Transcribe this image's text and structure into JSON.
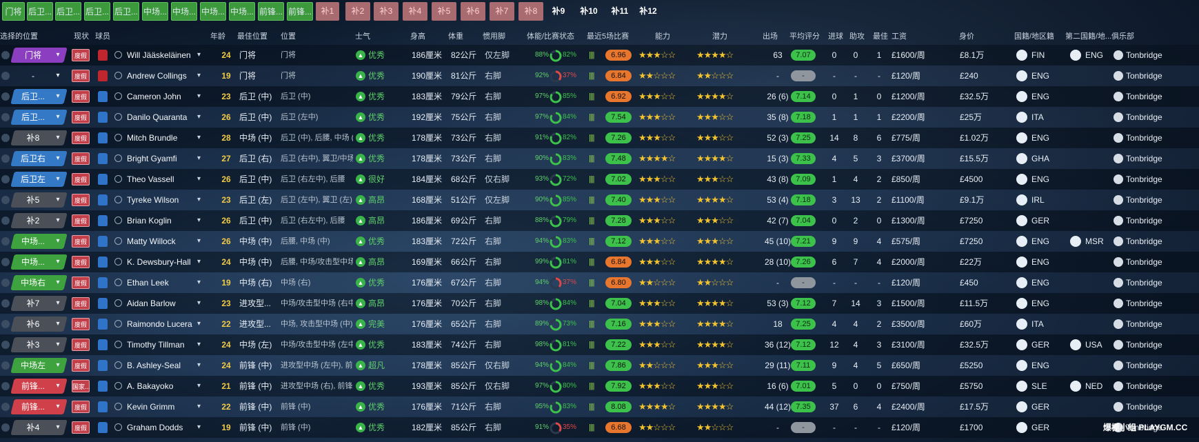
{
  "tabs": [
    "门将",
    "后卫...",
    "后卫...",
    "后卫...",
    "后卫...",
    "中场...",
    "中场...",
    "中场...",
    "中场...",
    "前锋...",
    "前锋...",
    "补1",
    "补2",
    "补3",
    "补4",
    "补5",
    "补6",
    "补7",
    "补8",
    "补9",
    "补10",
    "补11",
    "补12"
  ],
  "headers": {
    "selected_position": "选择的位置",
    "status": "现状",
    "player": "球员",
    "age": "年龄",
    "best_position": "最佳位置",
    "position": "位置",
    "morale": "士气",
    "height": "身高",
    "weight": "体重",
    "foot": "惯用脚",
    "fitness": "体能/比赛状态",
    "last5": "最近5场比赛",
    "ability": "能力",
    "potential": "潜力",
    "appearances": "出场",
    "avg_rating": "平均评分",
    "goals": "进球",
    "assists": "助攻",
    "pom": "最佳",
    "wage": "工资",
    "value": "身价",
    "nationality": "国籍/地区籍",
    "second_nationality": "第二国籍/地...",
    "club": "俱乐部"
  },
  "players": [
    {
      "sel": "门将",
      "selc": "gk",
      "status": "度假",
      "kit": "red",
      "name": "Will Jääskeläinen",
      "age": "24",
      "best": "门将",
      "pos": "门将",
      "morale": "优秀",
      "height": "186厘米",
      "weight": "82公斤",
      "foot": "仅左脚",
      "fit": "88%",
      "cond": "82%",
      "form": "||||",
      "avr": "6.96",
      "avrc": "#e8762c",
      "ab": "★★★☆☆",
      "pt": "★★★★☆",
      "apps": "63",
      "avg": "7.07",
      "gls": "0",
      "ast": "0",
      "pom": "1",
      "wage": "£1600/周",
      "val": "£8.1万",
      "nat": "FIN",
      "nat2": "ENG",
      "club": "Tonbridge"
    },
    {
      "sel": "-",
      "selc": "none",
      "status": "度假",
      "kit": "red",
      "name": "Andrew Collings",
      "age": "19",
      "best": "门将",
      "pos": "门将",
      "morale": "优秀",
      "height": "190厘米",
      "weight": "81公斤",
      "foot": "右脚",
      "fit": "92%",
      "cond": "37%",
      "form": "||||",
      "avr": "6.84",
      "avrc": "#e8762c",
      "ab": "★★☆☆☆",
      "pt": "★★☆☆☆",
      "apps": "-",
      "avg": "-",
      "gls": "-",
      "ast": "-",
      "pom": "-",
      "wage": "£120/周",
      "val": "£240",
      "nat": "ENG",
      "nat2": "",
      "club": "Tonbridge"
    },
    {
      "sel": "后卫...",
      "selc": "df",
      "status": "度假",
      "kit": "blue",
      "name": "Cameron John",
      "age": "23",
      "best": "后卫 (中)",
      "pos": "后卫 (中)",
      "morale": "优秀",
      "height": "183厘米",
      "weight": "79公斤",
      "foot": "右脚",
      "fit": "97%",
      "cond": "85%",
      "form": "||||",
      "avr": "6.92",
      "avrc": "#e8762c",
      "ab": "★★★☆☆",
      "pt": "★★★★☆",
      "apps": "26 (6)",
      "avg": "7.14",
      "gls": "0",
      "ast": "1",
      "pom": "0",
      "wage": "£1200/周",
      "val": "£32.5万",
      "nat": "ENG",
      "nat2": "",
      "club": "Tonbridge"
    },
    {
      "sel": "后卫...",
      "selc": "df",
      "status": "度假",
      "kit": "blue",
      "name": "Danilo Quaranta",
      "age": "26",
      "best": "后卫 (中)",
      "pos": "后卫 (左中)",
      "morale": "优秀",
      "height": "192厘米",
      "weight": "75公斤",
      "foot": "右脚",
      "fit": "97%",
      "cond": "84%",
      "form": "||||",
      "avr": "7.54",
      "avrc": "#3cc24b",
      "ab": "★★★☆☆",
      "pt": "★★★☆☆",
      "apps": "35 (8)",
      "avg": "7.18",
      "gls": "1",
      "ast": "1",
      "pom": "1",
      "wage": "£2200/周",
      "val": "£25万",
      "nat": "ITA",
      "nat2": "",
      "club": "Tonbridge"
    },
    {
      "sel": "补8",
      "selc": "sub",
      "status": "度假",
      "kit": "blue",
      "name": "Mitch Brundle",
      "age": "28",
      "best": "中场 (中)",
      "pos": "后卫 (中), 后腰, 中场 (中)",
      "morale": "优秀",
      "height": "178厘米",
      "weight": "73公斤",
      "foot": "右脚",
      "fit": "91%",
      "cond": "82%",
      "form": "||||",
      "avr": "7.26",
      "avrc": "#3cc24b",
      "ab": "★★★☆☆",
      "pt": "★★★☆☆",
      "apps": "52 (3)",
      "avg": "7.25",
      "gls": "14",
      "ast": "8",
      "pom": "6",
      "wage": "£775/周",
      "val": "£1.02万",
      "nat": "ENG",
      "nat2": "",
      "club": "Tonbridge"
    },
    {
      "sel": "后卫右",
      "selc": "df",
      "status": "度假",
      "kit": "blue",
      "name": "Bright Gyamfi",
      "age": "27",
      "best": "后卫 (右)",
      "pos": "后卫 (右中), 翼卫/中场 (右)",
      "morale": "优秀",
      "height": "178厘米",
      "weight": "73公斤",
      "foot": "右脚",
      "fit": "90%",
      "cond": "83%",
      "form": "||||",
      "avr": "7.48",
      "avrc": "#3cc24b",
      "ab": "★★★★☆",
      "pt": "★★★★☆",
      "apps": "15 (3)",
      "avg": "7.33",
      "gls": "4",
      "ast": "5",
      "pom": "3",
      "wage": "£3700/周",
      "val": "£15.5万",
      "nat": "GHA",
      "nat2": "",
      "club": "Tonbridge"
    },
    {
      "sel": "后卫左",
      "selc": "df",
      "status": "度假",
      "kit": "blue",
      "name": "Theo Vassell",
      "age": "26",
      "best": "后卫 (中)",
      "pos": "后卫 (右左中), 后腰",
      "morale": "很好",
      "height": "184厘米",
      "weight": "68公斤",
      "foot": "仅右脚",
      "fit": "93%",
      "cond": "72%",
      "form": "||||",
      "avr": "7.02",
      "avrc": "#3cc24b",
      "ab": "★★★☆☆",
      "pt": "★★★☆☆",
      "apps": "43 (8)",
      "avg": "7.09",
      "gls": "1",
      "ast": "4",
      "pom": "2",
      "wage": "£850/周",
      "val": "£4500",
      "nat": "ENG",
      "nat2": "",
      "club": "Tonbridge"
    },
    {
      "sel": "补5",
      "selc": "sub",
      "status": "度假",
      "kit": "blue",
      "name": "Tyreke Wilson",
      "age": "23",
      "best": "后卫 (左)",
      "pos": "后卫 (左中), 翼卫 (左)",
      "morale": "高昂",
      "height": "168厘米",
      "weight": "51公斤",
      "foot": "仅左脚",
      "fit": "90%",
      "cond": "85%",
      "form": "||||",
      "avr": "7.40",
      "avrc": "#3cc24b",
      "ab": "★★★☆☆",
      "pt": "★★★★☆",
      "apps": "53 (4)",
      "avg": "7.18",
      "gls": "3",
      "ast": "13",
      "pom": "2",
      "wage": "£1100/周",
      "val": "£9.1万",
      "nat": "IRL",
      "nat2": "",
      "club": "Tonbridge"
    },
    {
      "sel": "补2",
      "selc": "sub",
      "status": "度假",
      "kit": "blue",
      "name": "Brian Koglin",
      "age": "26",
      "best": "后卫 (中)",
      "pos": "后卫 (右左中), 后腰",
      "morale": "高昂",
      "height": "186厘米",
      "weight": "69公斤",
      "foot": "右脚",
      "fit": "88%",
      "cond": "79%",
      "form": "||||",
      "avr": "7.28",
      "avrc": "#3cc24b",
      "ab": "★★★☆☆",
      "pt": "★★★☆☆",
      "apps": "42 (7)",
      "avg": "7.04",
      "gls": "0",
      "ast": "2",
      "pom": "0",
      "wage": "£1300/周",
      "val": "£7250",
      "nat": "GER",
      "nat2": "",
      "club": "Tonbridge"
    },
    {
      "sel": "中场...",
      "selc": "mf",
      "status": "度假",
      "kit": "blue",
      "name": "Matty Willock",
      "age": "26",
      "best": "中场 (中)",
      "pos": "后腰, 中场 (中)",
      "morale": "优秀",
      "height": "183厘米",
      "weight": "72公斤",
      "foot": "右脚",
      "fit": "94%",
      "cond": "83%",
      "form": "||||",
      "avr": "7.12",
      "avrc": "#3cc24b",
      "ab": "★★★☆☆",
      "pt": "★★★☆☆",
      "apps": "45 (10)",
      "avg": "7.21",
      "gls": "9",
      "ast": "9",
      "pom": "4",
      "wage": "£575/周",
      "val": "£7250",
      "nat": "ENG",
      "nat2": "MSR",
      "club": "Tonbridge"
    },
    {
      "sel": "中场...",
      "selc": "mf",
      "status": "度假",
      "kit": "blue",
      "name": "K. Dewsbury-Hall",
      "age": "24",
      "best": "中场 (中)",
      "pos": "后腰, 中场/攻击型中场 (中)",
      "morale": "高昂",
      "height": "169厘米",
      "weight": "66公斤",
      "foot": "右脚",
      "fit": "99%",
      "cond": "81%",
      "form": "||||",
      "avr": "6.84",
      "avrc": "#e8762c",
      "ab": "★★★☆☆",
      "pt": "★★★★☆",
      "apps": "28 (10)",
      "avg": "7.26",
      "gls": "6",
      "ast": "7",
      "pom": "4",
      "wage": "£2000/周",
      "val": "£22万",
      "nat": "ENG",
      "nat2": "",
      "club": "Tonbridge"
    },
    {
      "sel": "中场右",
      "selc": "mf",
      "status": "度假",
      "kit": "blue",
      "name": "Ethan Leek",
      "age": "19",
      "best": "中场 (右)",
      "pos": "中场 (右)",
      "morale": "优秀",
      "height": "176厘米",
      "weight": "67公斤",
      "foot": "右脚",
      "fit": "94%",
      "cond": "37%",
      "form": "||||",
      "avr": "6.80",
      "avrc": "#e8762c",
      "ab": "★★☆☆☆",
      "pt": "★★☆☆☆",
      "apps": "-",
      "avg": "-",
      "gls": "-",
      "ast": "-",
      "pom": "-",
      "wage": "£120/周",
      "val": "£450",
      "nat": "ENG",
      "nat2": "",
      "club": "Tonbridge"
    },
    {
      "sel": "补7",
      "selc": "sub",
      "status": "度假",
      "kit": "blue",
      "name": "Aidan Barlow",
      "age": "23",
      "best": "进攻型...",
      "pos": "中场/攻击型中场 (右中), 前锋",
      "morale": "高昂",
      "height": "176厘米",
      "weight": "70公斤",
      "foot": "右脚",
      "fit": "98%",
      "cond": "84%",
      "form": "||||",
      "avr": "7.04",
      "avrc": "#3cc24b",
      "ab": "★★★☆☆",
      "pt": "★★★★☆",
      "apps": "53 (3)",
      "avg": "7.12",
      "gls": "7",
      "ast": "14",
      "pom": "3",
      "wage": "£1500/周",
      "val": "£11.5万",
      "nat": "ENG",
      "nat2": "",
      "club": "Tonbridge"
    },
    {
      "sel": "补6",
      "selc": "sub",
      "status": "度假",
      "kit": "blue",
      "name": "Raimondo Lucera",
      "age": "22",
      "best": "进攻型...",
      "pos": "中场, 攻击型中场 (中)",
      "morale": "完美",
      "height": "176厘米",
      "weight": "65公斤",
      "foot": "右脚",
      "fit": "89%",
      "cond": "73%",
      "form": "||||",
      "avr": "7.16",
      "avrc": "#3cc24b",
      "ab": "★★★☆☆",
      "pt": "★★★★☆",
      "apps": "18",
      "avg": "7.25",
      "gls": "4",
      "ast": "4",
      "pom": "2",
      "wage": "£3500/周",
      "val": "£60万",
      "nat": "ITA",
      "nat2": "",
      "club": "Tonbridge"
    },
    {
      "sel": "补3",
      "selc": "sub",
      "status": "度假",
      "kit": "blue",
      "name": "Timothy Tillman",
      "age": "24",
      "best": "中场 (左)",
      "pos": "中场/攻击型中场 (左中)",
      "morale": "优秀",
      "height": "183厘米",
      "weight": "74公斤",
      "foot": "右脚",
      "fit": "98%",
      "cond": "81%",
      "form": "||||",
      "avr": "7.22",
      "avrc": "#3cc24b",
      "ab": "★★★☆☆",
      "pt": "★★★★☆",
      "apps": "36 (12)",
      "avg": "7.12",
      "gls": "12",
      "ast": "4",
      "pom": "3",
      "wage": "£3100/周",
      "val": "£32.5万",
      "nat": "GER",
      "nat2": "USA",
      "club": "Tonbridge"
    },
    {
      "sel": "中场左",
      "selc": "mf",
      "status": "度假",
      "kit": "blue",
      "name": "B. Ashley-Seal",
      "age": "24",
      "best": "前锋 (中)",
      "pos": "进攻型中场 (左中), 前锋",
      "morale": "超凡",
      "height": "178厘米",
      "weight": "85公斤",
      "foot": "仅右脚",
      "fit": "94%",
      "cond": "84%",
      "form": "||||",
      "avr": "7.86",
      "avrc": "#3cc24b",
      "ab": "★★☆☆☆",
      "pt": "★★★☆☆",
      "apps": "29 (11)",
      "avg": "7.11",
      "gls": "9",
      "ast": "4",
      "pom": "5",
      "wage": "£650/周",
      "val": "£5250",
      "nat": "ENG",
      "nat2": "",
      "club": "Tonbridge"
    },
    {
      "sel": "前锋...",
      "selc": "fw",
      "status": "国家...",
      "kit": "blue",
      "name": "A. Bakayoko",
      "age": "21",
      "best": "前锋 (中)",
      "pos": "进攻型中场 (右), 前锋",
      "morale": "优秀",
      "height": "193厘米",
      "weight": "85公斤",
      "foot": "仅右脚",
      "fit": "97%",
      "cond": "80%",
      "form": "||||",
      "avr": "7.92",
      "avrc": "#3cc24b",
      "ab": "★★★☆☆",
      "pt": "★★★☆☆",
      "apps": "16 (6)",
      "avg": "7.01",
      "gls": "5",
      "ast": "0",
      "pom": "0",
      "wage": "£750/周",
      "val": "£5750",
      "nat": "SLE",
      "nat2": "NED",
      "club": "Tonbridge"
    },
    {
      "sel": "前锋...",
      "selc": "fw",
      "status": "度假",
      "kit": "blue",
      "name": "Kevin Grimm",
      "age": "22",
      "best": "前锋 (中)",
      "pos": "前锋 (中)",
      "morale": "优秀",
      "height": "176厘米",
      "weight": "71公斤",
      "foot": "右脚",
      "fit": "95%",
      "cond": "83%",
      "form": "||||",
      "avr": "8.08",
      "avrc": "#3cc24b",
      "ab": "★★★★☆",
      "pt": "★★★★☆",
      "apps": "44 (12)",
      "avg": "7.35",
      "gls": "37",
      "ast": "6",
      "pom": "4",
      "wage": "£2400/周",
      "val": "£17.5万",
      "nat": "GER",
      "nat2": "",
      "club": "Tonbridge"
    },
    {
      "sel": "补4",
      "selc": "sub",
      "status": "度假",
      "kit": "blue",
      "name": "Graham Dodds",
      "age": "19",
      "best": "前锋 (中)",
      "pos": "前锋 (中)",
      "morale": "优秀",
      "height": "182厘米",
      "weight": "85公斤",
      "foot": "右脚",
      "fit": "91%",
      "cond": "35%",
      "form": "||||",
      "avr": "6.68",
      "avrc": "#e8762c",
      "ab": "★★☆☆☆",
      "pt": "★★☆☆☆",
      "apps": "-",
      "avg": "-",
      "gls": "-",
      "ast": "-",
      "pom": "-",
      "wage": "£120/周",
      "val": "£1700",
      "nat": "GER",
      "nat2": "",
      "club": "Tonbridge"
    }
  ],
  "watermark": "爆棚小组 PLAYGM.CC",
  "colors": {
    "morale_green": "#39b34a",
    "avg_green": "#3cc24b",
    "avr_orange": "#e8762c",
    "gk": "#8b3fc0",
    "df": "#3479c6",
    "mf": "#3ea23e",
    "fw": "#d0404a",
    "sub": "#4b4f58"
  }
}
